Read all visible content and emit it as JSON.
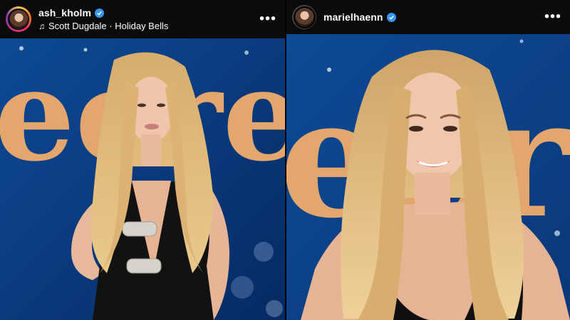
{
  "posts": [
    {
      "username": "ash_kholm",
      "verified": true,
      "music": "Scott Dugdale · Holiday Bells",
      "music_icon": "music-note-icon",
      "more_icon": "more-options-icon",
      "backdrop_text": "eere"
    },
    {
      "username": "marielhaenn",
      "verified": true,
      "more_icon": "more-options-icon",
      "backdrop_text": "ecre"
    }
  ],
  "colors": {
    "header_bg": "#0b0b0c",
    "backdrop_blue": "#0c3f86",
    "backdrop_letters": "#e2a46b",
    "verified_blue": "#3897f0",
    "hair": "#d9b173",
    "dress": "#111111"
  }
}
